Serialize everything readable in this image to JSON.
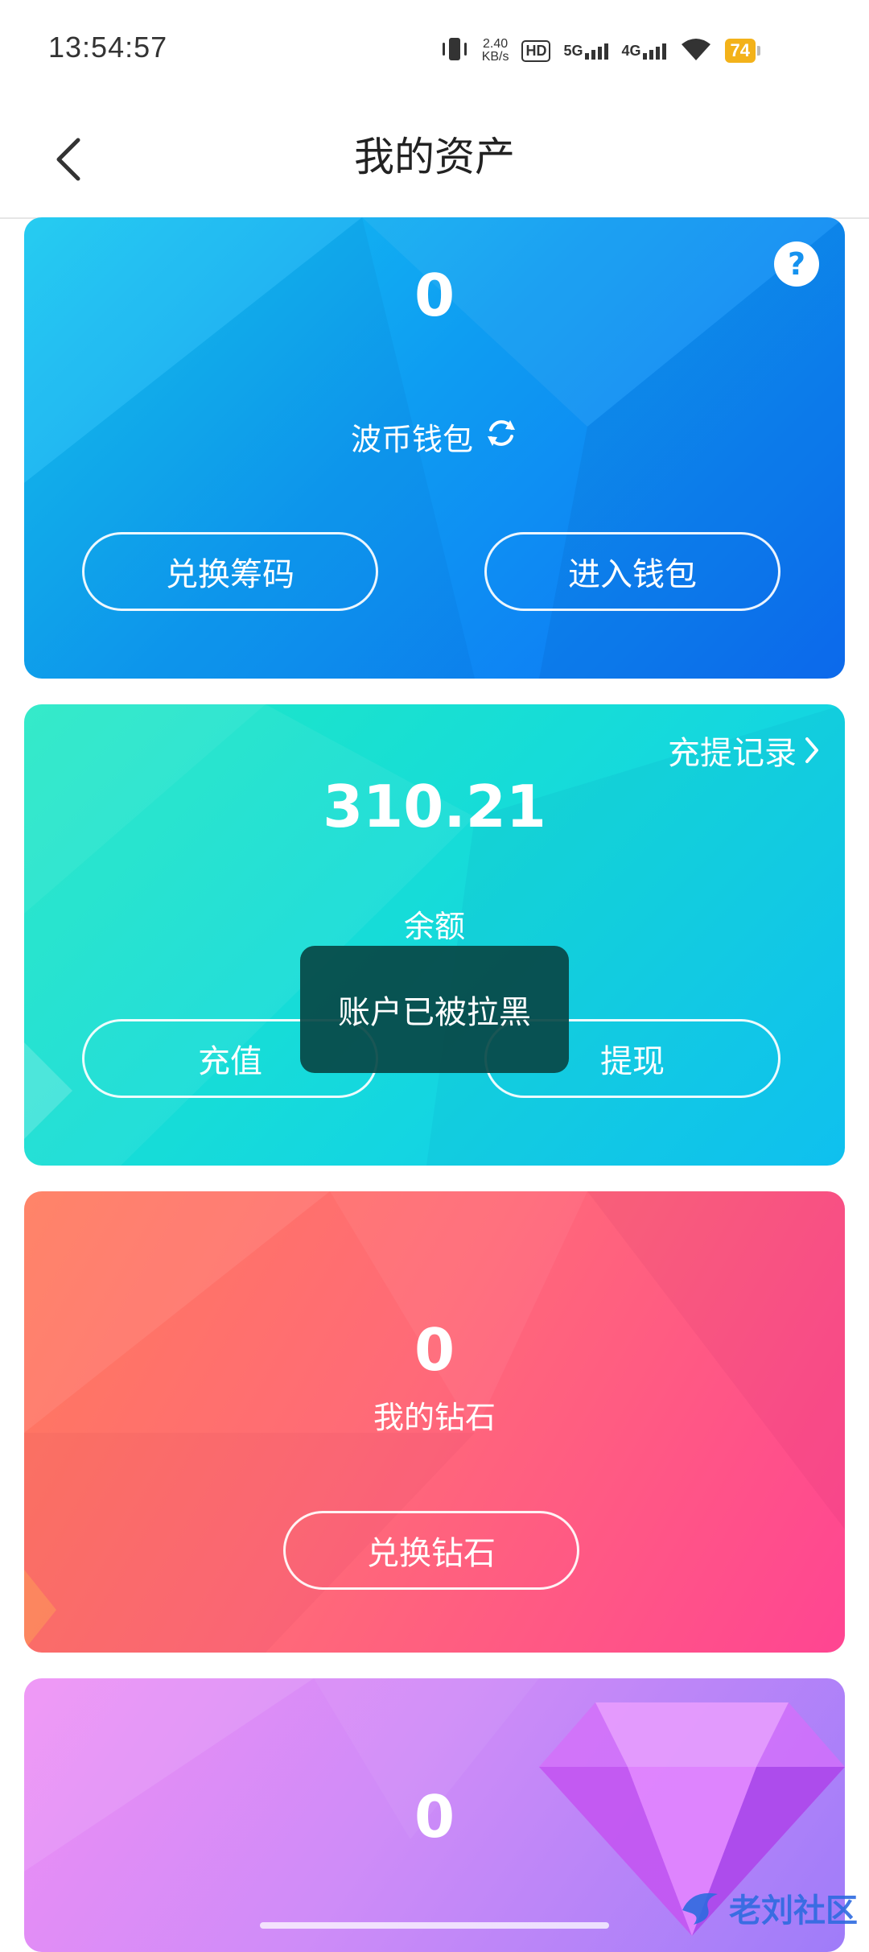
{
  "status_bar": {
    "time": "13:54:57",
    "net_speed_value": "2.40",
    "net_speed_unit": "KB/s",
    "hd_label": "HD",
    "network_1": "5G",
    "network_2": "4G",
    "battery": "74",
    "battery_color": "#f3b21a"
  },
  "header": {
    "title": "我的资产"
  },
  "cards": {
    "wallet": {
      "amount": "0",
      "label": "波币钱包",
      "buttons": [
        "兑换筹码",
        "进入钱包"
      ],
      "help_symbol": "?"
    },
    "balance": {
      "amount": "310.21",
      "label": "余额",
      "records_link": "充提记录",
      "buttons": [
        "充值",
        "提现"
      ]
    },
    "diamond": {
      "amount": "0",
      "label": "我的钻石",
      "button": "兑换钻石"
    },
    "gem": {
      "amount": "0"
    }
  },
  "toast": {
    "message": "账户已被拉黑"
  },
  "watermark": {
    "text": "老刘社区"
  },
  "icons": {
    "back": "chevron-left-icon",
    "refresh": "refresh-icon",
    "help": "help-icon",
    "records": "chevron-right-icon",
    "gem": "gem-icon"
  }
}
